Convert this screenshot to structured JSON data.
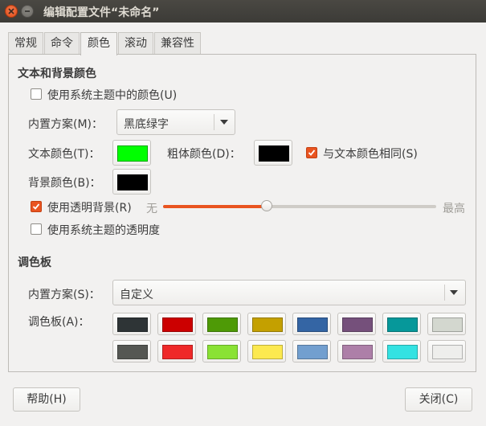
{
  "window": {
    "title": "编辑配置文件“未命名”"
  },
  "tabs": [
    {
      "label": "常规"
    },
    {
      "label": "命令"
    },
    {
      "label": "颜色"
    },
    {
      "label": "滚动"
    },
    {
      "label": "兼容性"
    }
  ],
  "active_tab": "颜色",
  "text_bg": {
    "heading": "文本和背景颜色",
    "use_theme_colors": {
      "label": "使用系统主题中的颜色(U)",
      "checked": false
    },
    "scheme_label": "内置方案(M)：",
    "scheme_value": "黑底绿字",
    "text_color_label": "文本颜色(T)：",
    "text_color": "#00ff00",
    "bold_color_label": "粗体颜色(D)：",
    "bold_color": "#000000",
    "same_as_text": {
      "label": "与文本颜色相同(S)",
      "checked": true
    },
    "bg_color_label": "背景颜色(B)：",
    "bg_color": "#000000",
    "transparent_bg": {
      "label": "使用透明背景(R)",
      "checked": true
    },
    "slider_min_label": "无",
    "slider_max_label": "最高",
    "transparency_level": 0.38,
    "use_theme_transparency": {
      "label": "使用系统主题的透明度",
      "checked": false
    }
  },
  "palette": {
    "heading": "调色板",
    "scheme_label": "内置方案(S)：",
    "scheme_value": "自定义",
    "palette_label": "调色板(A)：",
    "colors": [
      "#2e3436",
      "#cc0000",
      "#4e9a06",
      "#c4a000",
      "#3465a4",
      "#75507b",
      "#06989a",
      "#d3d7cf",
      "#555753",
      "#ef2929",
      "#8ae234",
      "#fce94f",
      "#729fcf",
      "#ad7fa8",
      "#34e2e2",
      "#eeeeec"
    ]
  },
  "buttons": {
    "help": "帮助(H)",
    "close": "关闭(C)"
  },
  "accent_color": "#e95420"
}
